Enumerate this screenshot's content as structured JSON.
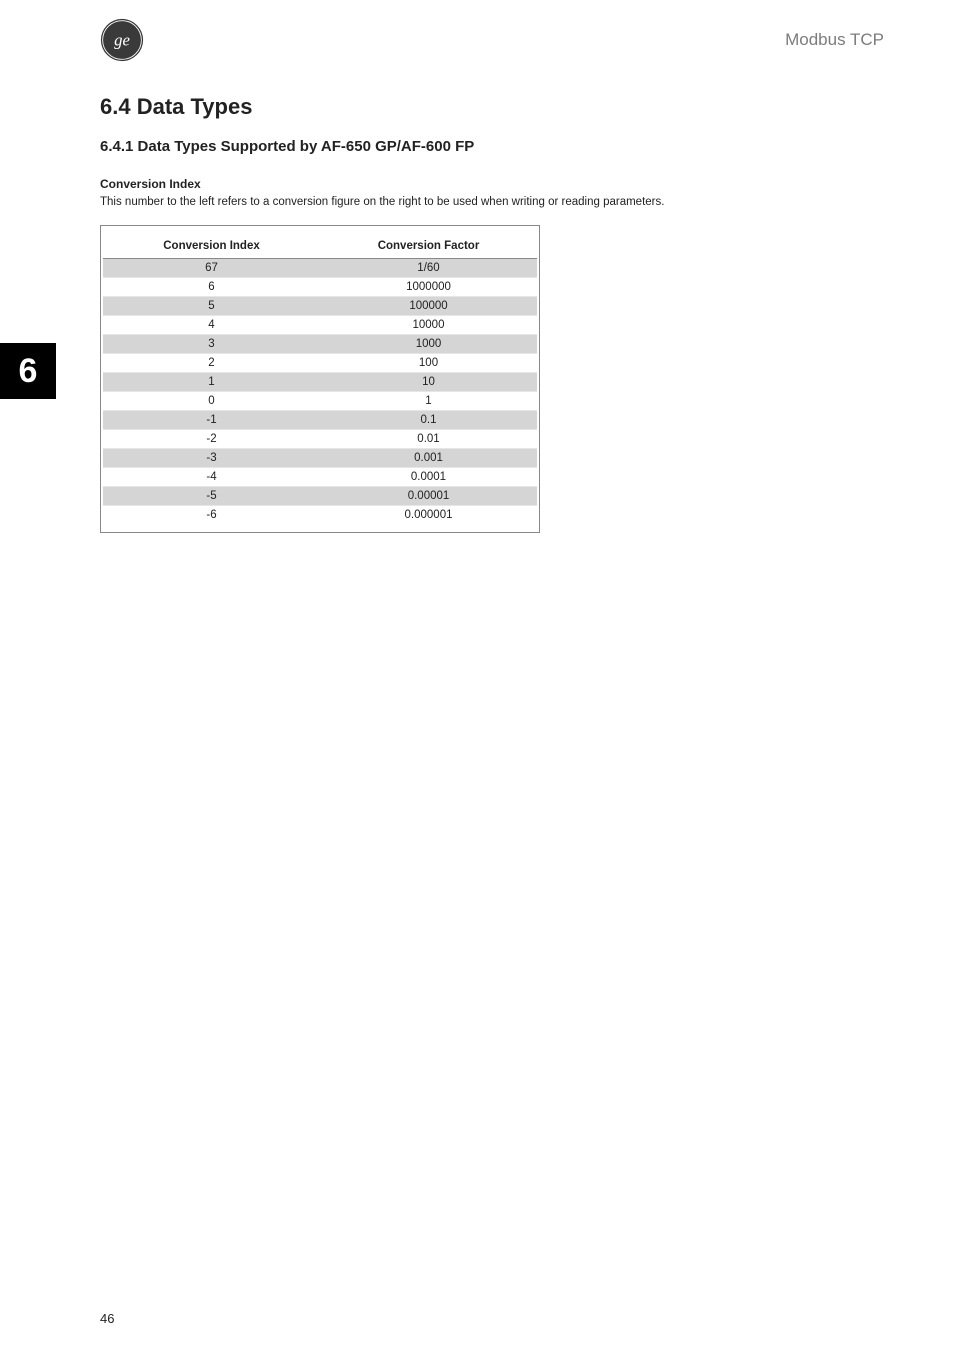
{
  "header": {
    "right_text": "Modbus TCP"
  },
  "section_tab": "6",
  "section_heading": "6.4  Data Types",
  "subheading": "6.4.1  Data Types Supported by AF-650 GP/AF-600 FP",
  "para_head": "Conversion Index",
  "para_body": "This number to the left refers to a conversion figure on the right to be used when writing or reading parameters.",
  "table": {
    "col1_header": "Conversion Index",
    "col2_header": "Conversion Factor",
    "rows": [
      {
        "index": "67",
        "factor": "1/60",
        "shade": true
      },
      {
        "index": "6",
        "factor": "1000000",
        "shade": false
      },
      {
        "index": "5",
        "factor": "100000",
        "shade": true
      },
      {
        "index": "4",
        "factor": "10000",
        "shade": false
      },
      {
        "index": "3",
        "factor": "1000",
        "shade": true
      },
      {
        "index": "2",
        "factor": "100",
        "shade": false
      },
      {
        "index": "1",
        "factor": "10",
        "shade": true
      },
      {
        "index": "0",
        "factor": "1",
        "shade": false
      },
      {
        "index": "-1",
        "factor": "0.1",
        "shade": true
      },
      {
        "index": "-2",
        "factor": "0.01",
        "shade": false
      },
      {
        "index": "-3",
        "factor": "0.001",
        "shade": true
      },
      {
        "index": "-4",
        "factor": "0.0001",
        "shade": false
      },
      {
        "index": "-5",
        "factor": "0.00001",
        "shade": true
      },
      {
        "index": "-6",
        "factor": "0.000001",
        "shade": false
      }
    ]
  },
  "page_number": "46"
}
